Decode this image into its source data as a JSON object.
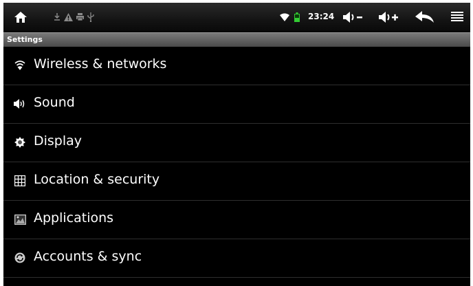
{
  "status": {
    "time": "23:24",
    "battery_color": "#33cc33"
  },
  "header": {
    "title": "Settings"
  },
  "settings": {
    "items": [
      {
        "label": "Wireless & networks",
        "icon": "wifi-icon"
      },
      {
        "label": "Sound",
        "icon": "speaker-icon"
      },
      {
        "label": "Display",
        "icon": "brightness-icon"
      },
      {
        "label": "Location & security",
        "icon": "grid-lock-icon"
      },
      {
        "label": "Applications",
        "icon": "applications-icon"
      },
      {
        "label": "Accounts & sync",
        "icon": "sync-icon"
      }
    ]
  }
}
